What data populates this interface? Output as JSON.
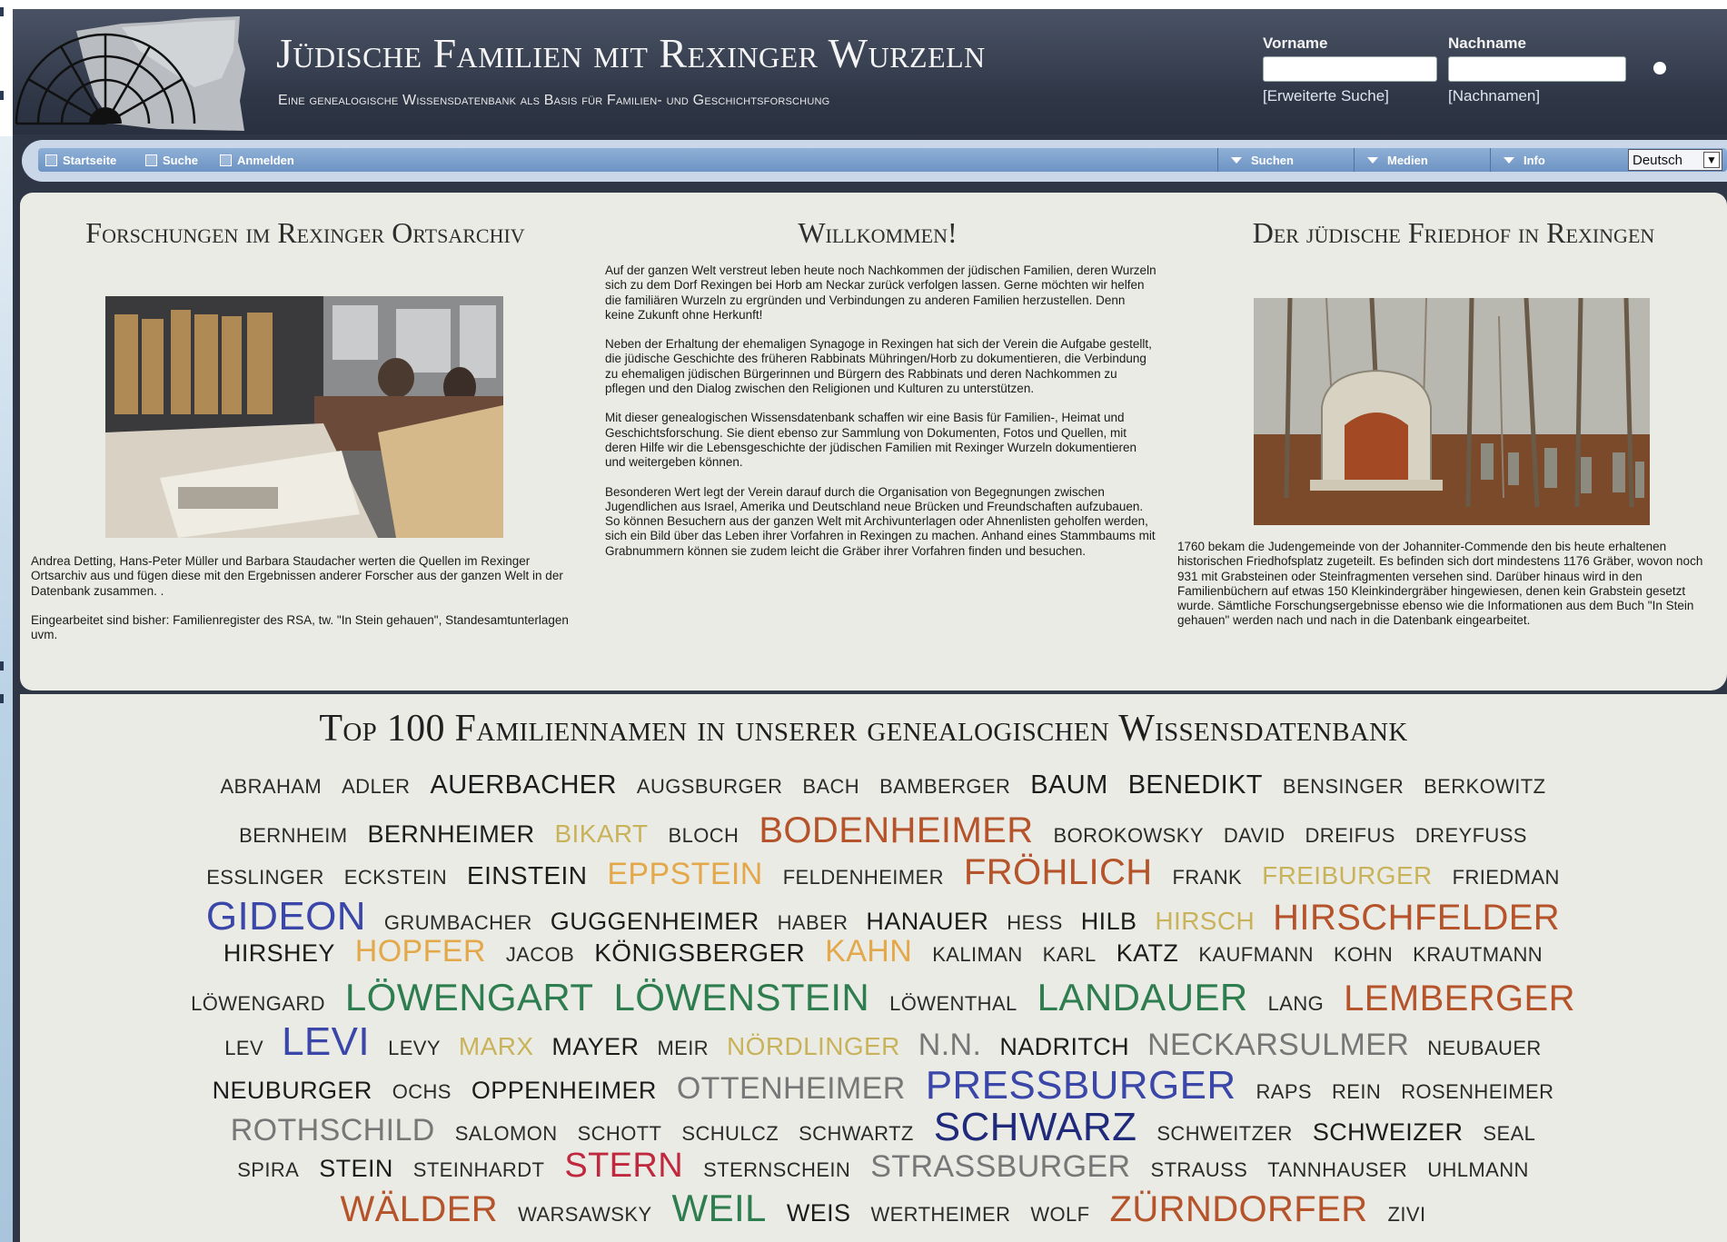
{
  "header": {
    "title": "Jüdische Familien mit Rexinger Wurzeln",
    "subtitle": "Eine genealogische Wissensdatenbank als Basis für Familien- und Geschichtsforschung",
    "search": {
      "firstname_label": "Vorname",
      "lastname_label": "Nachname",
      "firstname_value": "",
      "lastname_value": "",
      "advanced_link": "[Erweiterte Suche]",
      "surnames_link": "[Nachnamen]"
    }
  },
  "nav": {
    "items": [
      "Startseite",
      "Suche",
      "Anmelden"
    ],
    "dropdowns": [
      "Suchen",
      "Medien",
      "Info"
    ],
    "language": "Deutsch"
  },
  "left_column": {
    "title": "Forschungen im Rexinger Ortsarchiv",
    "paragraphs": [
      "Andrea Detting, Hans-Peter Müller und Barbara Staudacher werten die Quellen im Rexinger Ortsarchiv aus und fügen diese mit den Ergebnissen anderer Forscher aus der ganzen Welt in der Datenbank zusammen. .",
      "Eingearbeitet sind bisher: Familienregister des RSA, tw. \"In Stein gehauen\", Standesamtunterlagen uvm."
    ]
  },
  "center_column": {
    "title": "Willkommen!",
    "paragraphs": [
      "Auf der ganzen Welt verstreut leben heute noch Nachkommen der jüdischen Familien, deren Wurzeln sich zu dem Dorf Rexingen bei Horb am Neckar zurück verfolgen lassen. Gerne möchten wir helfen die familiären Wurzeln zu ergründen und Verbindungen zu anderen Familien herzustellen. Denn keine Zukunft ohne Herkunft!",
      "Neben der Erhaltung der ehemaligen Synagoge in Rexingen hat sich der Verein die Aufgabe gestellt, die jüdische Geschichte des früheren Rabbinats Mühringen/Horb zu dokumentieren, die Verbindung zu ehemaligen jüdischen Bürgerinnen und Bürgern des Rabbinats und deren Nachkommen zu pflegen und den Dialog zwischen den Religionen und Kulturen zu unterstützen.",
      "Mit dieser genealogischen Wissensdatenbank schaffen wir eine Basis für Familien-, Heimat und Geschichtsforschung. Sie dient ebenso zur Sammlung von Dokumenten, Fotos und Quellen, mit deren Hilfe wir die Lebensgeschichte der jüdischen Familien mit Rexinger Wurzeln dokumentieren und weitergeben können.",
      "Besonderen Wert legt der Verein darauf durch die Organisation von Begegnungen zwischen Jugendlichen aus Israel, Amerika und Deutschland neue Brücken und Freundschaften aufzubauen. So können Besuchern aus der ganzen Welt mit Archivunterlagen oder Ahnenlisten geholfen werden, sich ein Bild über das Leben ihrer Vorfahren in Rexingen zu machen. Anhand eines Stammbaums mit Grabnummern können sie zudem leicht die Gräber ihrer Vorfahren finden und besuchen."
    ]
  },
  "right_column": {
    "title": "Der jüdische Friedhof in Rexingen",
    "paragraphs": [
      "1760 bekam die Judengemeinde von der Johanniter-Commende den bis heute erhaltenen historischen Friedhofsplatz zugeteilt. Es befinden sich dort mindestens 1176 Gräber, wovon noch 931 mit Grabsteinen oder Steinfragmenten versehen sind. Darüber hinaus wird in den Familienbüchern auf etwas 150 Kleinkindergräber hingewiesen, denen kein Grabstein gesetzt wurde. Sämtliche Forschungsergebnisse ebenso wie die Informationen aus dem Buch \"In Stein gehauen\" werden nach und nach in die Datenbank eingearbeitet."
    ]
  },
  "top100": {
    "title": "Top 100 Familiennamen in unserer genealogischen Wissensdatenbank",
    "lines": [
      [
        [
          "Abraham",
          22,
          "#2b2b2b"
        ],
        [
          "Adler",
          22,
          "#2b2b2b"
        ],
        [
          "Auerbacher",
          29,
          "#1c1c1c"
        ],
        [
          "Augsburger",
          22,
          "#2b2b2b"
        ],
        [
          "Bach",
          22,
          "#2b2b2b"
        ],
        [
          "Bamberger",
          22,
          "#2b2b2b"
        ],
        [
          "Baum",
          29,
          "#1c1c1c"
        ],
        [
          "Benedikt",
          29,
          "#1c1c1c"
        ],
        [
          "Bensinger",
          22,
          "#2b2b2b"
        ],
        [
          "Berkowitz",
          22,
          "#2b2b2b"
        ]
      ],
      [
        [
          "Bernheim",
          22,
          "#2b2b2b"
        ],
        [
          "Bernheimer",
          27,
          "#1c1c1c"
        ],
        [
          "Bikart",
          28,
          "#c9b35a"
        ],
        [
          "Bloch",
          22,
          "#2b2b2b"
        ],
        [
          "Bodenheimer",
          40,
          "#b5532a"
        ],
        [
          "Borokowsky",
          22,
          "#2b2b2b"
        ],
        [
          "David",
          22,
          "#2b2b2b"
        ],
        [
          "Dreifus",
          22,
          "#2b2b2b"
        ],
        [
          "Dreyfuss",
          22,
          "#2b2b2b"
        ]
      ],
      [
        [
          "Eßlinger",
          22,
          "#2b2b2b"
        ],
        [
          "Eckstein",
          22,
          "#2b2b2b"
        ],
        [
          "Einstein",
          28,
          "#1c1c1c"
        ],
        [
          "Eppstein",
          34,
          "#e3a84a"
        ],
        [
          "Feldenheimer",
          22,
          "#2b2b2b"
        ],
        [
          "Fröhlich",
          40,
          "#b5532a"
        ],
        [
          "Frank",
          22,
          "#2b2b2b"
        ],
        [
          "Freiburger",
          28,
          "#c9b35a"
        ],
        [
          "Friedman",
          22,
          "#2b2b2b"
        ]
      ],
      [
        [
          "Gideon",
          44,
          "#3a47a8"
        ],
        [
          "Grumbacher",
          22,
          "#2b2b2b"
        ],
        [
          "Guggenheimer",
          27,
          "#1c1c1c"
        ],
        [
          "Haber",
          22,
          "#2b2b2b"
        ],
        [
          "Hanauer",
          27,
          "#1c1c1c"
        ],
        [
          "Heß",
          22,
          "#2b2b2b"
        ],
        [
          "Hilb",
          27,
          "#1c1c1c"
        ],
        [
          "Hirsch",
          28,
          "#c9b35a"
        ],
        [
          "Hirschfelder",
          40,
          "#b5532a"
        ]
      ],
      [
        [
          "Hirshey",
          27,
          "#1c1c1c"
        ],
        [
          "Hopfer",
          34,
          "#e3a84a"
        ],
        [
          "Jacob",
          22,
          "#2b2b2b"
        ],
        [
          "Königsberger",
          28,
          "#1c1c1c"
        ],
        [
          "Kahn",
          34,
          "#e3a84a"
        ],
        [
          "Kaliman",
          22,
          "#2b2b2b"
        ],
        [
          "Karl",
          22,
          "#2b2b2b"
        ],
        [
          "Katz",
          27,
          "#1c1c1c"
        ],
        [
          "Kaufmann",
          22,
          "#2b2b2b"
        ],
        [
          "Kohn",
          22,
          "#2b2b2b"
        ],
        [
          "Krautmann",
          22,
          "#2b2b2b"
        ]
      ],
      [
        [
          "Löwengard",
          22,
          "#2b2b2b"
        ],
        [
          "Löwengart",
          42,
          "#2e7d4f"
        ],
        [
          "Löwenstein",
          42,
          "#2e7d4f"
        ],
        [
          "Löwenthal",
          22,
          "#2b2b2b"
        ],
        [
          "Landauer",
          42,
          "#2e7d4f"
        ],
        [
          "Lang",
          22,
          "#2b2b2b"
        ],
        [
          "Lemberger",
          40,
          "#b5532a"
        ]
      ],
      [
        [
          "Lev",
          22,
          "#2b2b2b"
        ],
        [
          "Levi",
          44,
          "#3a47a8"
        ],
        [
          "Levy",
          22,
          "#2b2b2b"
        ],
        [
          "Marx",
          28,
          "#c9b35a"
        ],
        [
          "Mayer",
          27,
          "#1c1c1c"
        ],
        [
          "Meir",
          22,
          "#2b2b2b"
        ],
        [
          "Nördlinger",
          28,
          "#c9b35a"
        ],
        [
          "N.N.",
          34,
          "#777777"
        ],
        [
          "Nadritch",
          27,
          "#1c1c1c"
        ],
        [
          "Neckarsulmer",
          34,
          "#777777"
        ],
        [
          "Neubauer",
          22,
          "#2b2b2b"
        ]
      ],
      [
        [
          "Neuburger",
          27,
          "#1c1c1c"
        ],
        [
          "Ochs",
          22,
          "#2b2b2b"
        ],
        [
          "Oppenheimer",
          27,
          "#1c1c1c"
        ],
        [
          "Ottenheimer",
          34,
          "#777777"
        ],
        [
          "Pressburger",
          44,
          "#3a47a8"
        ],
        [
          "Raps",
          22,
          "#2b2b2b"
        ],
        [
          "Rein",
          22,
          "#2b2b2b"
        ],
        [
          "Rosenheimer",
          22,
          "#2b2b2b"
        ]
      ],
      [
        [
          "Rothschild",
          34,
          "#777777"
        ],
        [
          "Salomon",
          22,
          "#2b2b2b"
        ],
        [
          "Schott",
          22,
          "#2b2b2b"
        ],
        [
          "Schulcz",
          22,
          "#2b2b2b"
        ],
        [
          "Schwartz",
          22,
          "#2b2b2b"
        ],
        [
          "Schwarz",
          44,
          "#1f2a7a"
        ],
        [
          "Schweitzer",
          22,
          "#2b2b2b"
        ],
        [
          "Schweizer",
          27,
          "#1c1c1c"
        ],
        [
          "Seal",
          22,
          "#2b2b2b"
        ]
      ],
      [
        [
          "Spira",
          22,
          "#2b2b2b"
        ],
        [
          "Stein",
          27,
          "#1c1c1c"
        ],
        [
          "Steinhardt",
          22,
          "#2b2b2b"
        ],
        [
          "Stern",
          38,
          "#c0283e"
        ],
        [
          "Sternschein",
          22,
          "#2b2b2b"
        ],
        [
          "Straßburger",
          34,
          "#777777"
        ],
        [
          "Strauss",
          22,
          "#2b2b2b"
        ],
        [
          "Tannhauser",
          22,
          "#2b2b2b"
        ],
        [
          "Uhlmann",
          22,
          "#2b2b2b"
        ]
      ],
      [
        [
          "Wälder",
          40,
          "#b5532a"
        ],
        [
          "Warsawsky",
          22,
          "#2b2b2b"
        ],
        [
          "Weil",
          42,
          "#2e7d4f"
        ],
        [
          "Weis",
          27,
          "#1c1c1c"
        ],
        [
          "Wertheimer",
          22,
          "#2b2b2b"
        ],
        [
          "Wolf",
          22,
          "#2b2b2b"
        ],
        [
          "Zürndorfer",
          40,
          "#b5532a"
        ],
        [
          "Zivi",
          22,
          "#2b2b2b"
        ]
      ]
    ]
  },
  "colors": {
    "header_bg": "#2f3747",
    "content_bg": "#ebebe6",
    "nav_bar": "#7fa3cf"
  }
}
